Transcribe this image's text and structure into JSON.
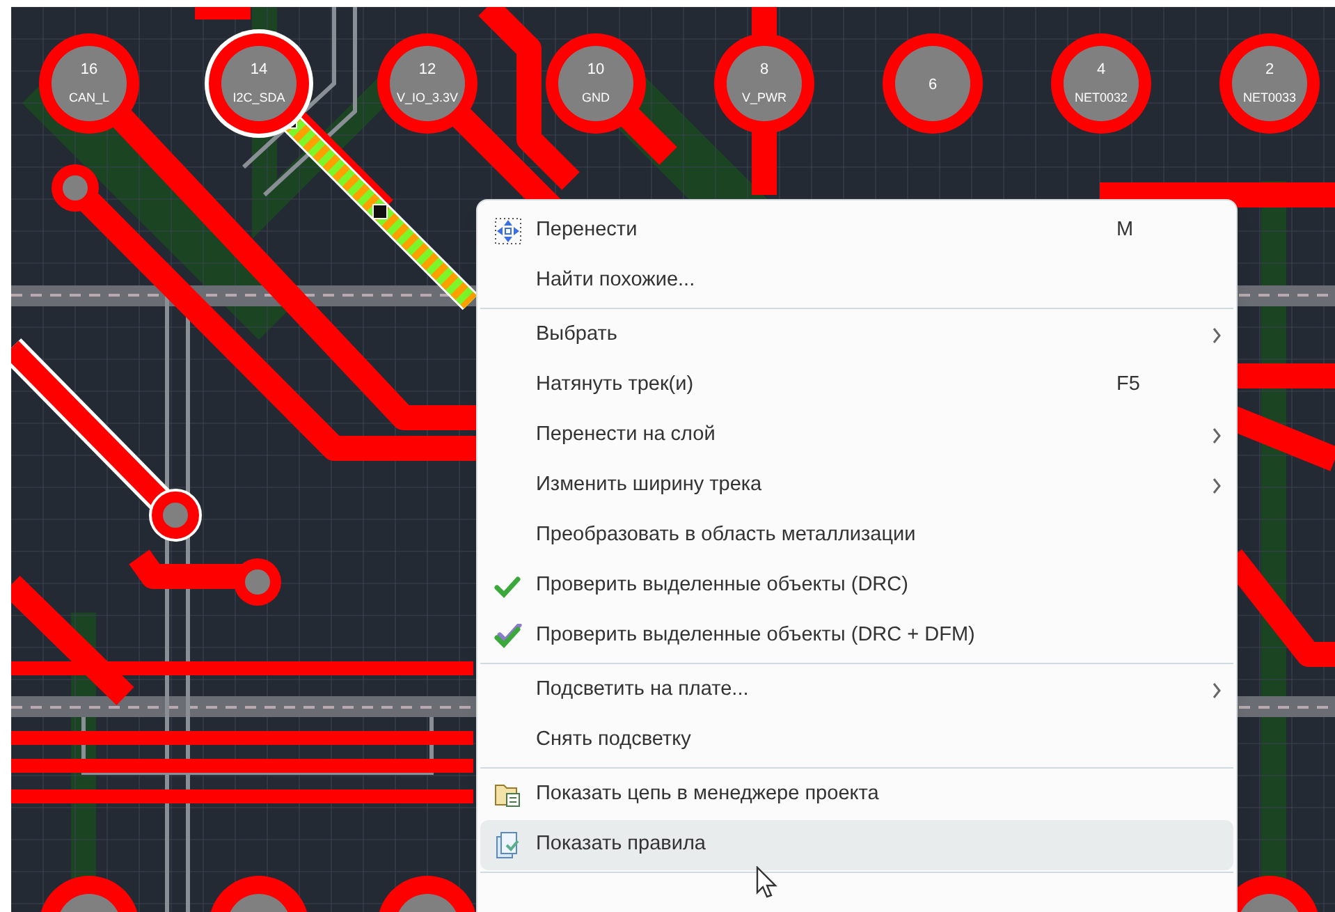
{
  "board": {
    "pads": [
      {
        "number": "16",
        "net": "CAN_L",
        "selected": false
      },
      {
        "number": "14",
        "net": "I2C_SDA",
        "selected": true
      },
      {
        "number": "12",
        "net": "V_IO_3.3V",
        "selected": false
      },
      {
        "number": "10",
        "net": "GND",
        "selected": false
      },
      {
        "number": "8",
        "net": "V_PWR",
        "selected": false
      },
      {
        "number": "6",
        "selected": false
      },
      {
        "number": "4",
        "net": "NET0032",
        "selected": false
      },
      {
        "number": "2",
        "net": "NET0033",
        "selected": false
      }
    ]
  },
  "context_menu": {
    "items": [
      {
        "kind": "item",
        "label": "Перенести",
        "shortcut": "M",
        "submenu": false,
        "selected": false
      },
      {
        "kind": "item",
        "label": "Найти похожие...",
        "submenu": false,
        "selected": false
      },
      {
        "kind": "separator"
      },
      {
        "kind": "item",
        "label": "Выбрать",
        "submenu": true,
        "selected": false
      },
      {
        "kind": "item",
        "label": "Натянуть трек(и)",
        "shortcut": "F5",
        "submenu": false,
        "selected": false
      },
      {
        "kind": "item",
        "label": "Перенести на слой",
        "submenu": true,
        "selected": false
      },
      {
        "kind": "item",
        "label": "Изменить ширину трека",
        "submenu": true,
        "selected": false
      },
      {
        "kind": "item",
        "label": "Преобразовать в область металлизации",
        "submenu": false,
        "selected": false
      },
      {
        "kind": "item",
        "label": "Проверить выделенные объекты (DRC)",
        "submenu": false,
        "selected": false
      },
      {
        "kind": "item",
        "label": "Проверить выделенные объекты (DRC + DFM)",
        "submenu": false,
        "selected": false
      },
      {
        "kind": "separator"
      },
      {
        "kind": "item",
        "label": "Подсветить на плате...",
        "submenu": true,
        "selected": false
      },
      {
        "kind": "item",
        "label": "Снять подсветку",
        "submenu": false,
        "selected": false
      },
      {
        "kind": "separator"
      },
      {
        "kind": "item",
        "label": "Показать цепь в менеджере проекта",
        "submenu": false,
        "selected": false
      },
      {
        "kind": "item",
        "label": "Показать правила",
        "submenu": false,
        "selected": true
      },
      {
        "kind": "separator"
      }
    ]
  }
}
